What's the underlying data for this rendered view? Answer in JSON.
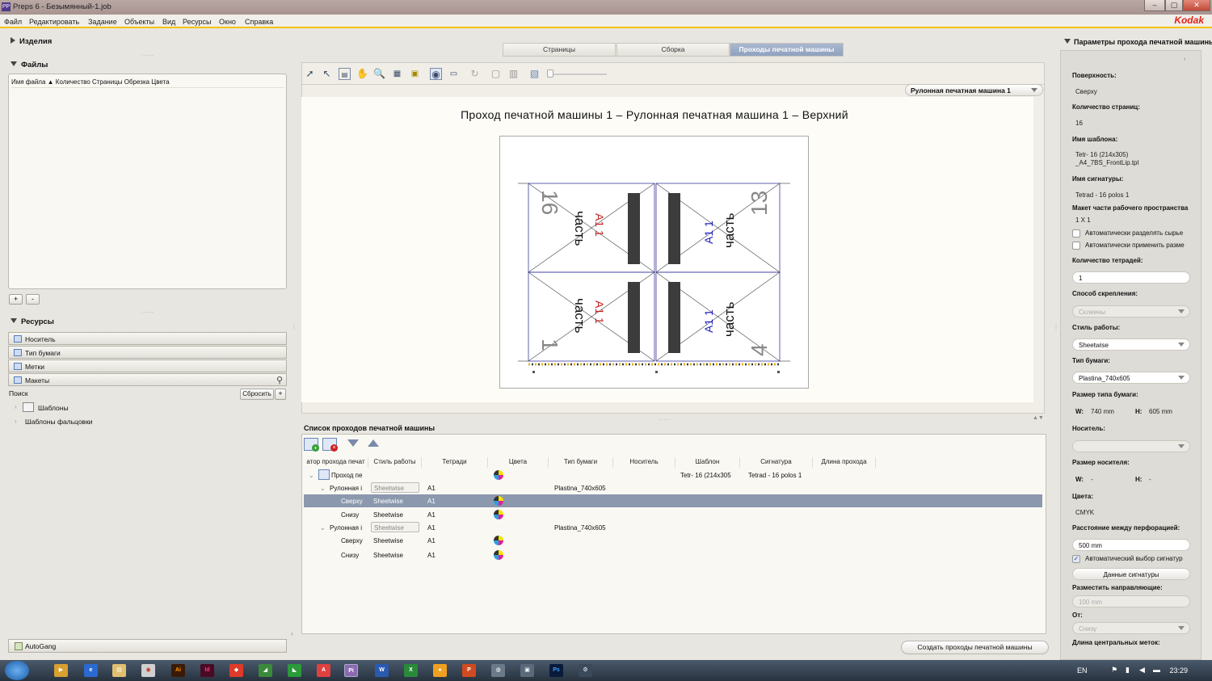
{
  "window": {
    "title": "Preps 6 - Безымянный-1.job",
    "app_icon": "PP",
    "controls": [
      "–",
      "▢",
      "✕"
    ]
  },
  "menu": {
    "items": [
      "Файл",
      "Редактировать",
      "Задание",
      "Объекты",
      "Вид",
      "Ресурсы",
      "Окно",
      "Справка"
    ],
    "brand": "Kodak"
  },
  "left": {
    "products": "Изделия",
    "files": "Файлы",
    "files_header": "Имя файла ▲ Количество Страницы Обрезка Цвета",
    "add": "+",
    "remove": "-",
    "resources": "Ресурсы",
    "resource_items": [
      "Носитель",
      "Тип бумаги",
      "Метки",
      "Макеты"
    ],
    "search_label": "Поиск",
    "reset_label": "Сбросить",
    "tree": [
      "Шаблоны",
      "Шаблоны фальцовки"
    ],
    "autogang": "AutoGang"
  },
  "tabs": [
    "Страницы",
    "Сборка",
    "Проходы печатной машины"
  ],
  "viewer": {
    "machine": "Рулонная печатная машина 1",
    "title": "Проход печатной машины 1 – Рулонная печатная машина 1 – Верхний",
    "pages": [
      {
        "num": "16",
        "label": "часть",
        "code": "A1 1"
      },
      {
        "num": "13",
        "label": "часть",
        "code": "A1 1"
      },
      {
        "num": "1",
        "label": "часть",
        "code": "A1 1"
      },
      {
        "num": "4",
        "label": "часть",
        "code": "A1 1"
      }
    ]
  },
  "list": {
    "title": "Список проходов печатной машины",
    "headers": [
      "атор прохода печат",
      "Стиль работы",
      "Тетради",
      "Цвета",
      "Тип бумаги",
      "Носитель",
      "Шаблон",
      "Сигнатура",
      "Длина прохода"
    ],
    "rows": [
      {
        "name": "Проход пе",
        "style": "",
        "tetr": "",
        "paper": "",
        "template": "Tetr- 16 (214x305",
        "signature": "Tetrad - 16 polos 1"
      },
      {
        "name": "Рулонная і",
        "style": "Sheetwise",
        "tetr": "A1",
        "paper": "Plastina_740x605",
        "template": "",
        "signature": ""
      },
      {
        "name": "Сверху",
        "style": "Sheetwise",
        "tetr": "A1",
        "paper": "",
        "template": "",
        "signature": ""
      },
      {
        "name": "Снизу",
        "style": "Sheetwise",
        "tetr": "A1",
        "paper": "",
        "template": "",
        "signature": ""
      },
      {
        "name": "Рулонная і",
        "style": "Sheetwise",
        "tetr": "A1",
        "paper": "Plastina_740x605",
        "template": "",
        "signature": ""
      },
      {
        "name": "Сверху",
        "style": "Sheetwise",
        "tetr": "A1",
        "paper": "",
        "template": "",
        "signature": ""
      },
      {
        "name": "Снизу",
        "style": "Sheetwise",
        "tetr": "A1",
        "paper": "",
        "template": "",
        "signature": ""
      }
    ],
    "create_button": "Создать проходы печатной машины"
  },
  "right": {
    "title": "Параметры прохода печатной машины",
    "surface_label": "Поверхность:",
    "surface": "Сверху",
    "pages_label": "Количество страниц:",
    "pages": "16",
    "template_label": "Имя шаблона:",
    "template_1": "Tetr- 16 (214x305)",
    "template_2": "_A4_7BS_FrontLip.tpl",
    "signature_label": "Имя сигнатуры:",
    "signature": "Tetrad - 16 polos 1",
    "layout_label": "Макет части рабочего пространства",
    "layout": "1 X 1",
    "auto_split": "Автоматически разделять сырье",
    "auto_apply": "Автоматически применить разме",
    "tetr_count_label": "Количество тетрадей:",
    "tetr_count": "1",
    "binding_label": "Способ скрепления:",
    "binding": "Склеены",
    "work_style_label": "Стиль работы:",
    "work_style": "Sheetwise",
    "paper_type_label": "Тип бумаги:",
    "paper_type": "Plastina_740x605",
    "paper_size_label": "Размер типа бумаги:",
    "w_label": "W:",
    "w": "740 mm",
    "h_label": "H:",
    "h": "605 mm",
    "media_label": "Носитель:",
    "media": "",
    "media_size_label": "Размер носителя:",
    "mw": "-",
    "mh": "-",
    "colors_label": "Цвета:",
    "colors": "CMYK",
    "perf_label": "Расстояние между перфорацией:",
    "perf": "500 mm",
    "auto_sig": "Автоматический выбор сигнатур",
    "sig_data": "Данные сигнатуры",
    "guides_label": "Разместить направляющие:",
    "guides": "100 mm",
    "from_label": "От:",
    "from": "Снизу",
    "center_marks_label": "Длина центральных меток:"
  },
  "taskbar": {
    "lang": "EN",
    "time": "23:29"
  }
}
